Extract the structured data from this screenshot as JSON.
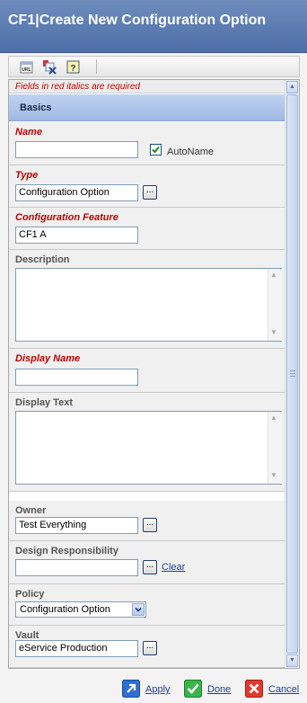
{
  "window": {
    "title": "CF1|Create New Configuration Option"
  },
  "toolbar": {
    "items": [
      {
        "name": "url-icon",
        "label": "URL"
      },
      {
        "name": "clear-fields-icon"
      },
      {
        "name": "help-icon",
        "label": "?"
      }
    ]
  },
  "form": {
    "required_note": "Fields in red italics are required",
    "section_title": "Basics",
    "name": {
      "label": "Name",
      "value": "",
      "autoname_label": "AutoName",
      "autoname_checked": true
    },
    "type": {
      "label": "Type",
      "value": "Configuration Option"
    },
    "configuration_feature": {
      "label": "Configuration Feature",
      "value": "CF1 A"
    },
    "description": {
      "label": "Description",
      "value": ""
    },
    "display_name": {
      "label": "Display Name",
      "value": ""
    },
    "display_text": {
      "label": "Display Text",
      "value": ""
    },
    "owner": {
      "label": "Owner",
      "value": "Test Everything"
    },
    "design_responsibility": {
      "label": "Design Responsibility",
      "value": "",
      "clear_label": "Clear"
    },
    "policy": {
      "label": "Policy",
      "value": "Configuration Option"
    },
    "vault": {
      "label": "Vault",
      "value": "eService Production"
    },
    "chooser_label": "..."
  },
  "footer": {
    "apply": "Apply",
    "done": "Done",
    "cancel": "Cancel"
  },
  "colors": {
    "title_bar": "#5a7ab0",
    "required": "#c00000",
    "link": "#1f3f9a",
    "section_header": "#b0c8ec"
  }
}
